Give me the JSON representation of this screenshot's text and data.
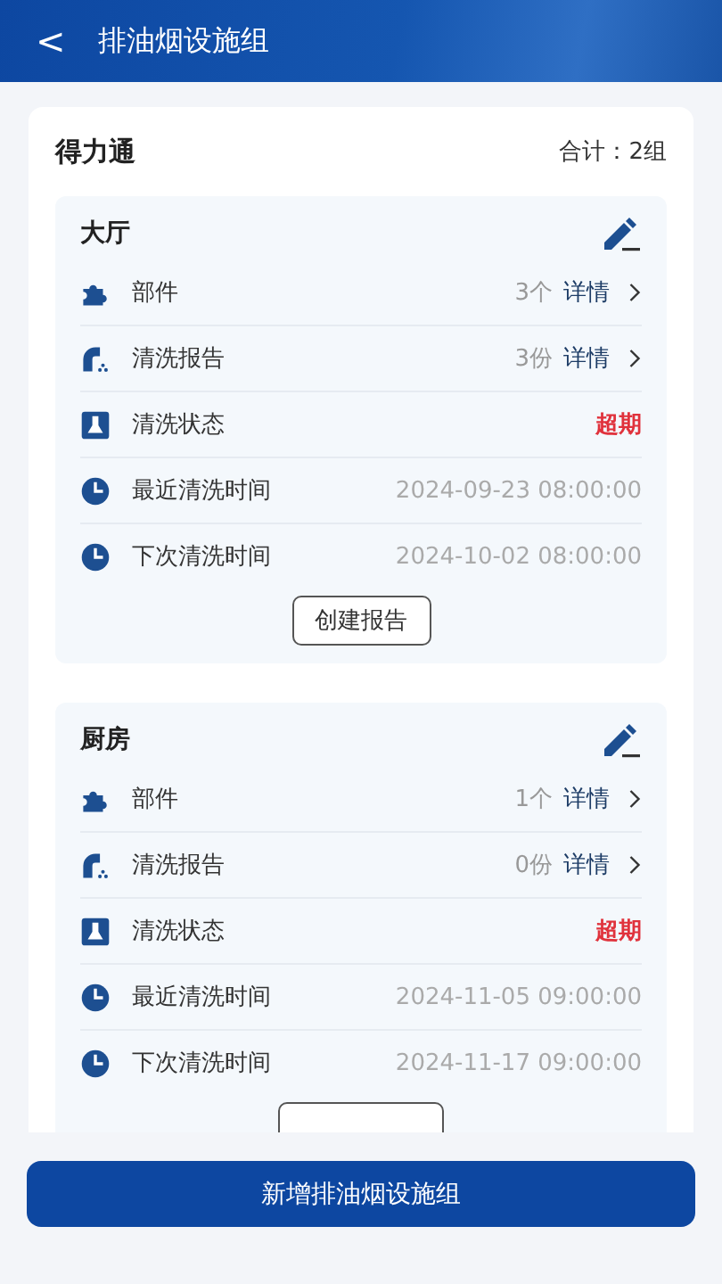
{
  "header": {
    "back_icon": "<",
    "title": "排油烟设施组"
  },
  "group": {
    "name": "得力通",
    "total": "合计：2组"
  },
  "cards": [
    {
      "name": "大厅",
      "rows": [
        {
          "kind": "count",
          "label": "部件",
          "value": "3个",
          "link": "详情"
        },
        {
          "kind": "count",
          "label": "清洗报告",
          "value": "3份",
          "link": "详情"
        },
        {
          "kind": "status",
          "label": "清洗状态",
          "value": "超期"
        },
        {
          "kind": "time",
          "label": "最近清洗时间",
          "value": "2024-09-23 08:00:00"
        },
        {
          "kind": "time",
          "label": "下次清洗时间",
          "value": "2024-10-02 08:00:00"
        }
      ],
      "button": "创建报告"
    },
    {
      "name": "厨房",
      "rows": [
        {
          "kind": "count",
          "label": "部件",
          "value": "1个",
          "link": "详情"
        },
        {
          "kind": "count",
          "label": "清洗报告",
          "value": "0份",
          "link": "详情"
        },
        {
          "kind": "status",
          "label": "清洗状态",
          "value": "超期"
        },
        {
          "kind": "time",
          "label": "最近清洗时间",
          "value": "2024-11-05 09:00:00"
        },
        {
          "kind": "time",
          "label": "下次清洗时间",
          "value": "2024-11-17 09:00:00"
        }
      ],
      "button_cut_off": true
    }
  ],
  "footer_button": "新增排油烟设施组"
}
